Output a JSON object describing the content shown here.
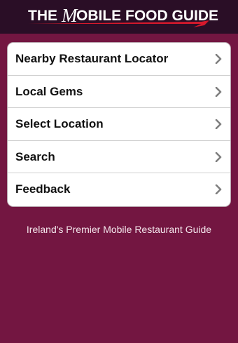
{
  "header": {
    "logo_text": "THE MOBILE FOOD GUIDE",
    "logo_prefix": "THE",
    "logo_script": "M",
    "logo_rest": "OBILE FOOD GUIDE"
  },
  "menu": {
    "items": [
      {
        "label": "Nearby Restaurant Locator",
        "icon": "chevron-right-icon"
      },
      {
        "label": "Local Gems",
        "icon": "chevron-right-icon"
      },
      {
        "label": "Select Location",
        "icon": "chevron-right-icon"
      },
      {
        "label": "Search",
        "icon": "chevron-right-icon"
      },
      {
        "label": "Feedback",
        "icon": "chevron-right-icon"
      }
    ]
  },
  "footer": {
    "tagline": "Ireland's Premier Mobile Restaurant Guide"
  },
  "colors": {
    "background": "#731641",
    "header_background": "#2a0e26",
    "accent_red": "#d7192c",
    "chevron": "#7f7f7f"
  }
}
